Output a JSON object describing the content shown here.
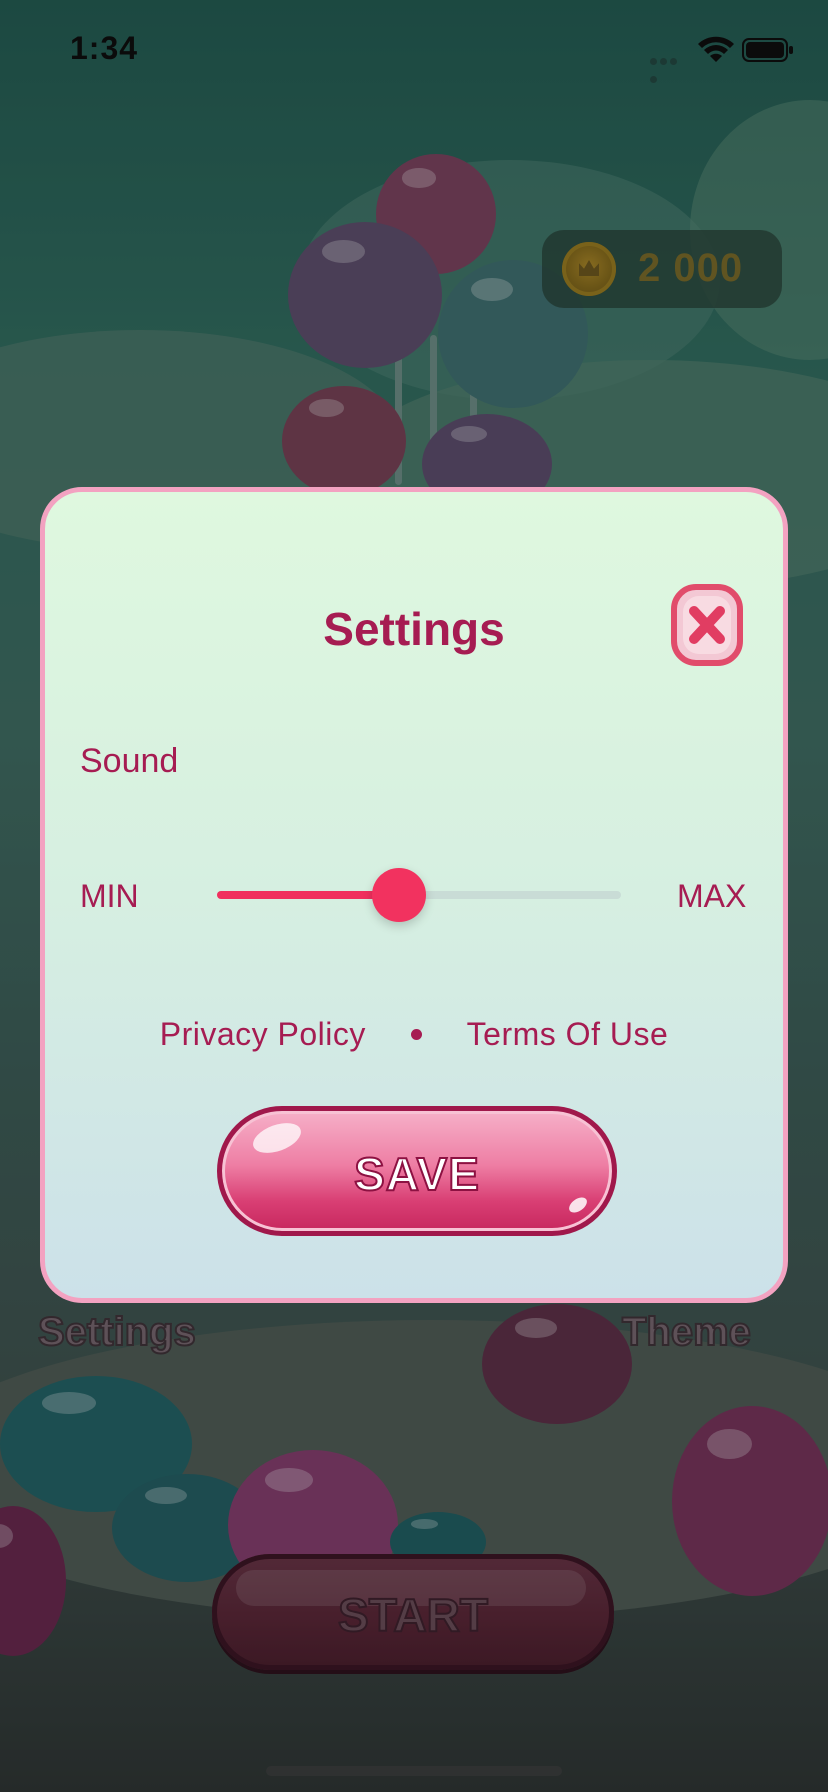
{
  "status_bar": {
    "time": "1:34"
  },
  "coins": {
    "value": "2 000"
  },
  "home_menu": {
    "settings_label": "Settings",
    "theme_label": "Theme",
    "start_label": "START"
  },
  "settings_dialog": {
    "title": "Settings",
    "sound_label": "Sound",
    "min_label": "MIN",
    "max_label": "MAX",
    "volume_level": 0.45,
    "privacy_label": "Privacy Policy",
    "terms_label": "Terms Of Use",
    "save_label": "SAVE"
  },
  "colors": {
    "accent": "#a61c52",
    "slider_fill": "#f0305e",
    "dialog_border": "#f3a2c1"
  },
  "icons": {
    "close": "close-icon",
    "coin": "coin-icon",
    "wifi": "wifi-icon",
    "battery": "battery-icon",
    "signal": "signal-icon"
  }
}
